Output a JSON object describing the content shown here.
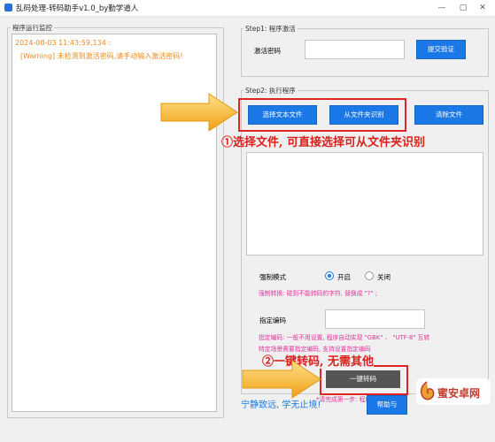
{
  "window": {
    "title": "乱码处理-转码助手v1.0_by勤学道人",
    "minimize": "—",
    "maximize": "▢",
    "close": "✕"
  },
  "log_panel": {
    "title": "程序运行监控",
    "lines": [
      "2024-08-03 11:43:59,134 :",
      "[Warning] 未检测到激活密码,请手动输入激活密码!"
    ],
    "color": "#f08a1d"
  },
  "step1": {
    "title": "Step1: 程序激活",
    "password_label": "激活密码",
    "password_value": "",
    "submit_label": "提交验证"
  },
  "step2": {
    "title": "Step2: 执行程序",
    "select_file_label": "选择文本文件",
    "from_folder_label": "从文件夹识别",
    "clear_label": "清除文件",
    "force_mode_label": "强制模式",
    "on_label": "开启",
    "off_label": "关闭",
    "force_selected": "开启",
    "force_hint": "强制转换: 碰到不能转码的字符, 替换成 \"?\" ;",
    "encoding_label": "指定编码",
    "encoding_value": "",
    "encoding_hint_1": "指定编码: 一般不用设置, 程序自动实现 \"GBK\" 、 \"UTF-8\" 互转",
    "encoding_hint_2": "特定场景需要指定编码, 支持设置指定编码",
    "convert_label": "一键转码",
    "convert_hint": "*请完成第一步: 程序激"
  },
  "footer": {
    "slogan": "宁静致远, 学无止境!",
    "help_label": "帮助与"
  },
  "annotations": {
    "one": "①选择文件, 可直接选择可从文件夹识别",
    "two": "②一键转码, 无需其他"
  },
  "watermark": {
    "text": "蜜安卓网"
  },
  "colors": {
    "accent": "#1a79e6",
    "annotation": "#d9201b",
    "hint": "#e3339a",
    "arrow": "#f5b21d"
  }
}
